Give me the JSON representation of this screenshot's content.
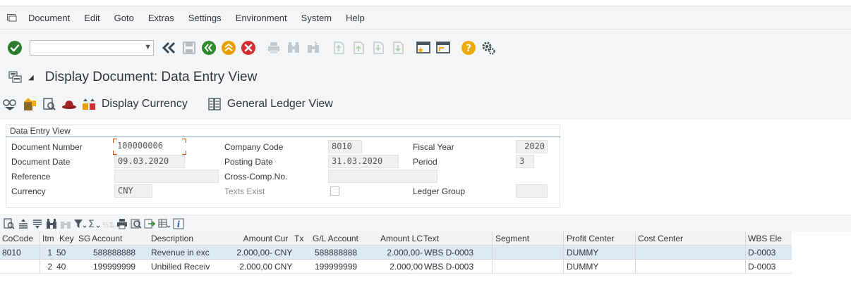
{
  "menu": {
    "items": [
      "Document",
      "Edit",
      "Goto",
      "Extras",
      "Settings",
      "Environment",
      "System",
      "Help"
    ]
  },
  "toolbar": {
    "command_value": "",
    "icons": [
      "enter-icon",
      "back-double-icon",
      "save-icon",
      "back-icon",
      "exit-icon",
      "cancel-icon",
      "print-icon",
      "find-icon",
      "find-next-icon",
      "first-page-icon",
      "previous-page-icon",
      "next-page-icon",
      "last-page-icon",
      "create-session-icon",
      "shortcut-icon",
      "help-icon",
      "customize-icon"
    ]
  },
  "title": {
    "text": "Display Document: Data Entry View"
  },
  "app_toolbar": {
    "display_currency": "Display Currency",
    "general_ledger_view": "General Ledger View"
  },
  "header": {
    "section_title": "Data Entry View",
    "document_number_label": "Document Number",
    "document_number": "100000006",
    "company_code_label": "Company Code",
    "company_code": "8010",
    "fiscal_year_label": "Fiscal Year",
    "fiscal_year": "2020",
    "document_date_label": "Document Date",
    "document_date": "09.03.2020",
    "posting_date_label": "Posting Date",
    "posting_date": "31.03.2020",
    "period_label": "Period",
    "period": "3",
    "reference_label": "Reference",
    "reference": "",
    "cross_comp_label": "Cross-Comp.No.",
    "cross_comp": "",
    "currency_label": "Currency",
    "currency": "CNY",
    "texts_exist_label": "Texts Exist",
    "ledger_group_label": "Ledger Group",
    "ledger_group": ""
  },
  "table": {
    "headers": [
      "CoCode",
      "Itm",
      "Key",
      "SG",
      "Account",
      "Description",
      "Amount",
      "Cur",
      "Tx",
      "G/L Account",
      "Amount LC",
      "Text",
      "Segment",
      "Profit Center",
      "Cost Center",
      "WBS Ele"
    ],
    "rows": [
      [
        "8010",
        "1",
        "50",
        "",
        "588888888",
        "Revenue in exc",
        "2.000,00-",
        "CNY",
        "",
        "588888888",
        "2.000,00-",
        "WBS D-0003",
        "",
        "DUMMY",
        "",
        "D-0003"
      ],
      [
        "",
        "2",
        "40",
        "",
        "199999999",
        "Unbilled Receiv",
        "2.000,00",
        "CNY",
        "",
        "199999999",
        "2.000,00",
        "WBS D-0003",
        "",
        "DUMMY",
        "",
        "D-0003"
      ]
    ]
  },
  "colors": {
    "shell_bg": "#f4f5f6",
    "selected_row": "#dde9f5",
    "ok_green": "#2b7d2b",
    "nav_green": "#2d8a2d",
    "exit_orange": "#e8a000",
    "cancel_red": "#d12f2f",
    "help_yellow": "#f0ab00",
    "focus_orange": "#d04a02"
  }
}
